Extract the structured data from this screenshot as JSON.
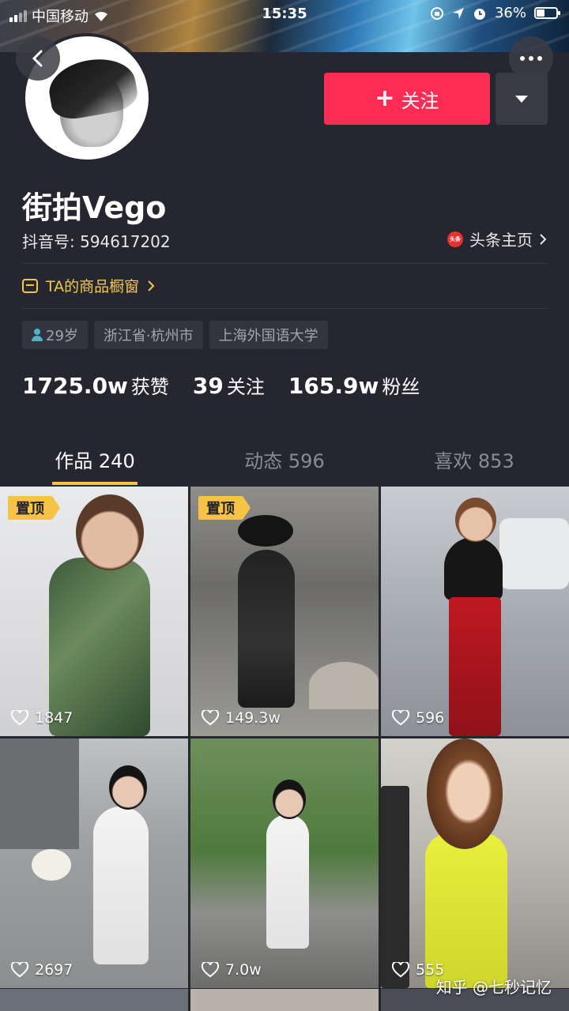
{
  "status_bar": {
    "carrier": "中国移动",
    "time": "15:35",
    "battery": "36%"
  },
  "profile": {
    "follow_label": "关注",
    "name": "街拍Vego",
    "douyin_id": "抖音号: 594617202",
    "toutiao_label": "头条主页",
    "toutiao_badge": "头条",
    "shop_label": "TA的商品橱窗",
    "tags": {
      "age": "29岁",
      "location": "浙江省·杭州市",
      "school": "上海外国语大学"
    },
    "stats": [
      {
        "num": "1725.0w",
        "label": "获赞"
      },
      {
        "num": "39",
        "label": "关注"
      },
      {
        "num": "165.9w",
        "label": "粉丝"
      }
    ]
  },
  "tabs": [
    {
      "label": "作品 240",
      "active": true
    },
    {
      "label": "动态 596",
      "active": false
    },
    {
      "label": "喜欢 853",
      "active": false
    }
  ],
  "grid": {
    "pin_label": "置顶",
    "items": [
      {
        "likes": "1847"
      },
      {
        "likes": "149.3w"
      },
      {
        "likes": "596"
      },
      {
        "likes": "2697"
      },
      {
        "likes": "7.0w"
      },
      {
        "likes": "555"
      }
    ]
  },
  "watermark": "知乎 @七秒记忆",
  "colors": {
    "accent": "#fd2c55",
    "pin": "#f6c344",
    "shop": "#f2c94c",
    "background": "#25262f"
  }
}
